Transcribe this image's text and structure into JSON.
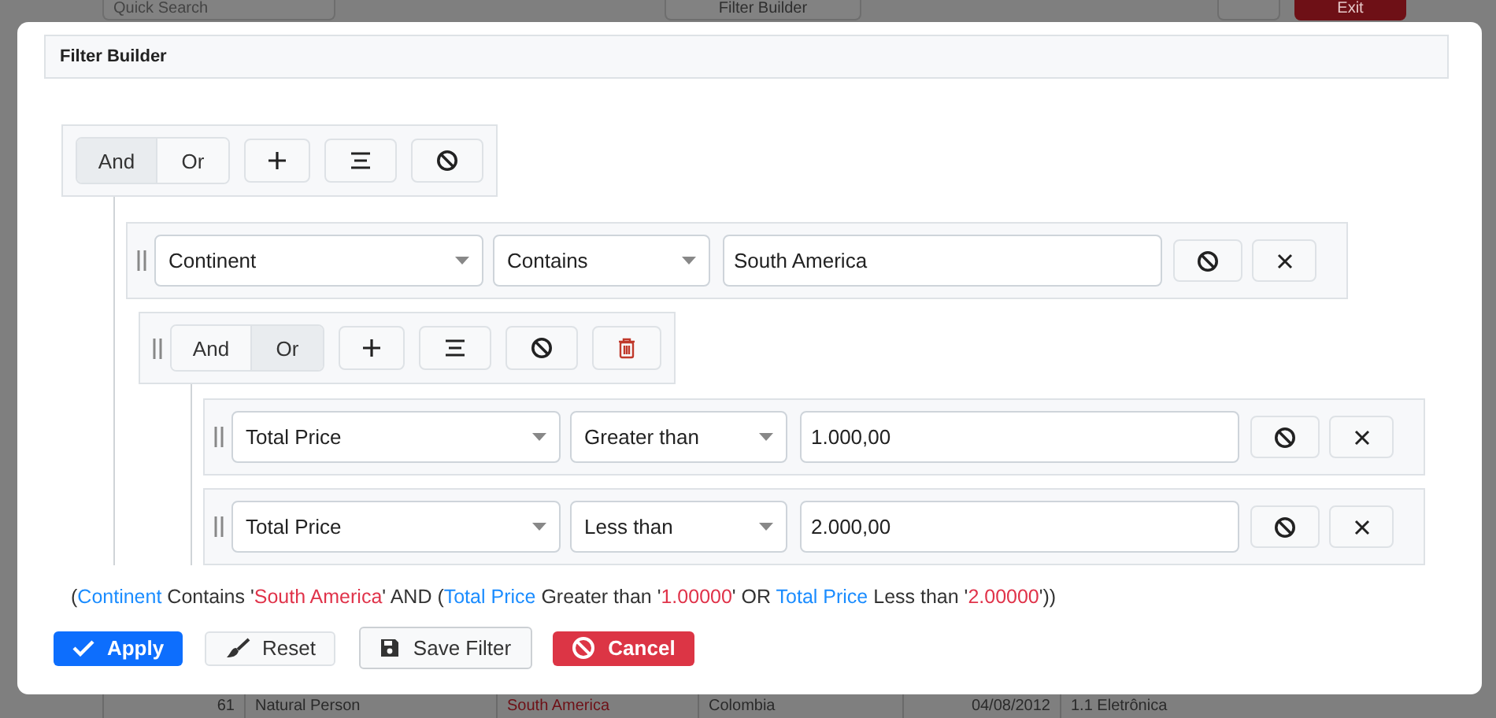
{
  "background": {
    "search": {
      "placeholder": "Quick Search"
    },
    "filter_button": "Filter Builder",
    "exit_button": "Exit",
    "table_row": [
      {
        "text": "61",
        "highlight": false
      },
      {
        "text": "Natural Person",
        "highlight": false
      },
      {
        "text": "South America",
        "highlight": true
      },
      {
        "text": "Colombia",
        "highlight": false
      },
      {
        "text": "04/08/2012",
        "highlight": false
      },
      {
        "text": "1.1 Eletrônica",
        "highlight": false
      }
    ]
  },
  "dialog": {
    "title": "Filter Builder",
    "root": {
      "kind": "group",
      "operators": [
        {
          "label": "And",
          "selected": true
        },
        {
          "label": "Or",
          "selected": false
        }
      ],
      "actions": [
        {
          "kind": "add"
        },
        {
          "kind": "add_group"
        },
        {
          "kind": "disable"
        }
      ],
      "children": [
        {
          "kind": "rule",
          "field": "Continent",
          "operator": "Contains",
          "value": "South America",
          "actions": [
            {
              "kind": "disable"
            },
            {
              "kind": "remove"
            }
          ]
        },
        {
          "kind": "group",
          "operators": [
            {
              "label": "And",
              "selected": false
            },
            {
              "label": "Or",
              "selected": true
            }
          ],
          "actions": [
            {
              "kind": "add"
            },
            {
              "kind": "add_group"
            },
            {
              "kind": "disable"
            },
            {
              "kind": "delete"
            }
          ],
          "children": [
            {
              "kind": "rule",
              "field": "Total Price",
              "operator": "Greater than",
              "value": "1.000,00",
              "actions": [
                {
                  "kind": "disable"
                },
                {
                  "kind": "remove"
                }
              ]
            },
            {
              "kind": "rule",
              "field": "Total Price",
              "operator": "Less than",
              "value": "2.000,00",
              "actions": [
                {
                  "kind": "disable"
                },
                {
                  "kind": "remove"
                }
              ]
            }
          ]
        }
      ]
    },
    "expression": [
      {
        "kind": "text",
        "text": "("
      },
      {
        "kind": "field",
        "text": "Continent"
      },
      {
        "kind": "text",
        "text": " Contains '"
      },
      {
        "kind": "value",
        "text": "South America"
      },
      {
        "kind": "text",
        "text": "' AND ("
      },
      {
        "kind": "field",
        "text": "Total Price"
      },
      {
        "kind": "text",
        "text": " Greater than '"
      },
      {
        "kind": "value",
        "text": "1.00000"
      },
      {
        "kind": "text",
        "text": "' OR "
      },
      {
        "kind": "field",
        "text": "Total Price"
      },
      {
        "kind": "text",
        "text": " Less than '"
      },
      {
        "kind": "value",
        "text": "2.00000"
      },
      {
        "kind": "text",
        "text": "'))"
      }
    ],
    "buttons": [
      {
        "kind": "apply",
        "label": "Apply"
      },
      {
        "kind": "reset",
        "label": "Reset"
      },
      {
        "kind": "save",
        "label": "Save Filter"
      },
      {
        "kind": "cancel",
        "label": "Cancel"
      }
    ]
  }
}
